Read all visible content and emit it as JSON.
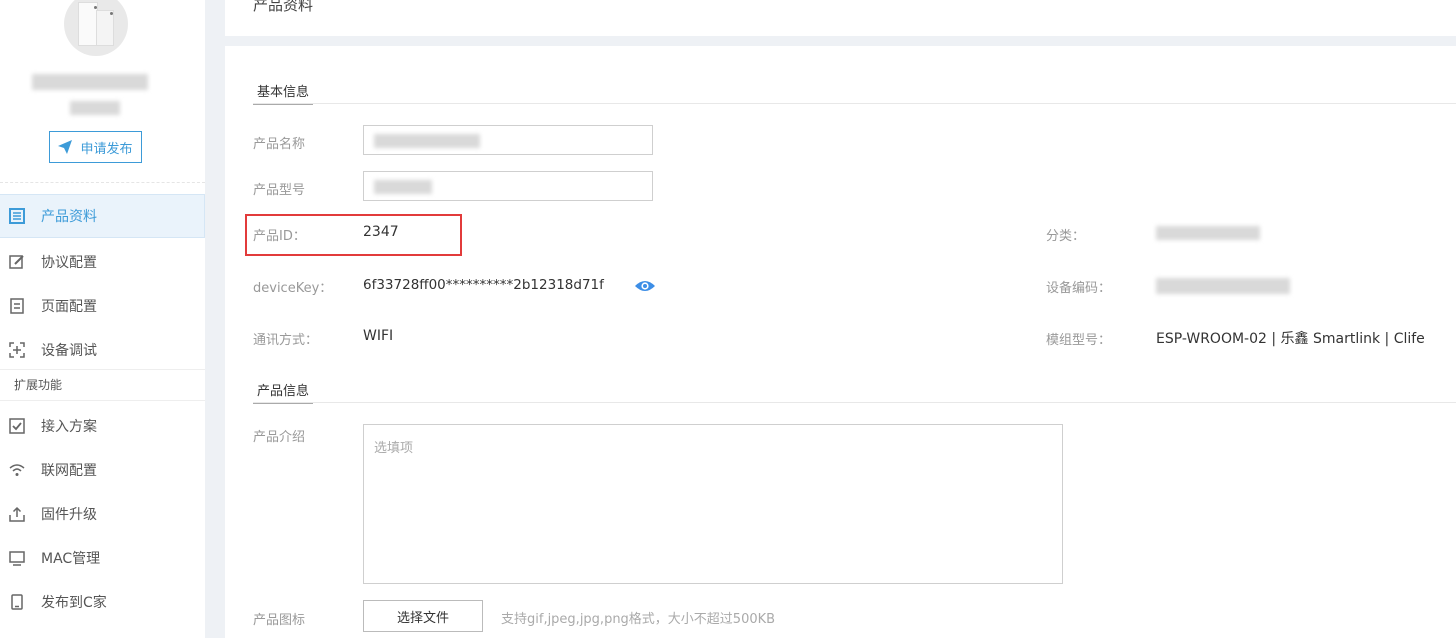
{
  "sidebar": {
    "apply_button": "申请发布",
    "items": [
      {
        "label": "产品资料",
        "icon": "list-icon",
        "active": true
      },
      {
        "label": "协议配置",
        "icon": "edit-icon"
      },
      {
        "label": "页面配置",
        "icon": "page-icon"
      },
      {
        "label": "设备调试",
        "icon": "debug-icon"
      }
    ],
    "section_title": "扩展功能",
    "ext_items": [
      {
        "label": "接入方案",
        "icon": "checkbox-icon"
      },
      {
        "label": "联网配置",
        "icon": "wifi-icon"
      },
      {
        "label": "固件升级",
        "icon": "upload-icon"
      },
      {
        "label": "MAC管理",
        "icon": "monitor-icon"
      },
      {
        "label": "发布到C家",
        "icon": "phone-icon"
      }
    ]
  },
  "page": {
    "title": "产品资料"
  },
  "basic": {
    "heading": "基本信息",
    "product_name_label": "产品名称",
    "product_model_label": "产品型号",
    "product_id_label": "产品ID：",
    "product_id_value": "2347",
    "category_label": "分类：",
    "device_key_label": "deviceKey：",
    "device_key_value": "6f33728ff00**********2b12318d71f",
    "device_code_label": "设备编码：",
    "comm_label": "通讯方式：",
    "comm_value": "WIFI",
    "module_label": "模组型号：",
    "module_value": "ESP-WROOM-02 | 乐鑫 Smartlink | Clife"
  },
  "product": {
    "heading": "产品信息",
    "intro_label": "产品介绍",
    "intro_placeholder": "选填项",
    "icon_label": "产品图标",
    "choose_file": "选择文件",
    "format_hint": "支持gif,jpeg,jpg,png格式，大小不超过500KB"
  },
  "colors": {
    "accent": "#3d9bd8",
    "highlight": "#e23b3b"
  }
}
